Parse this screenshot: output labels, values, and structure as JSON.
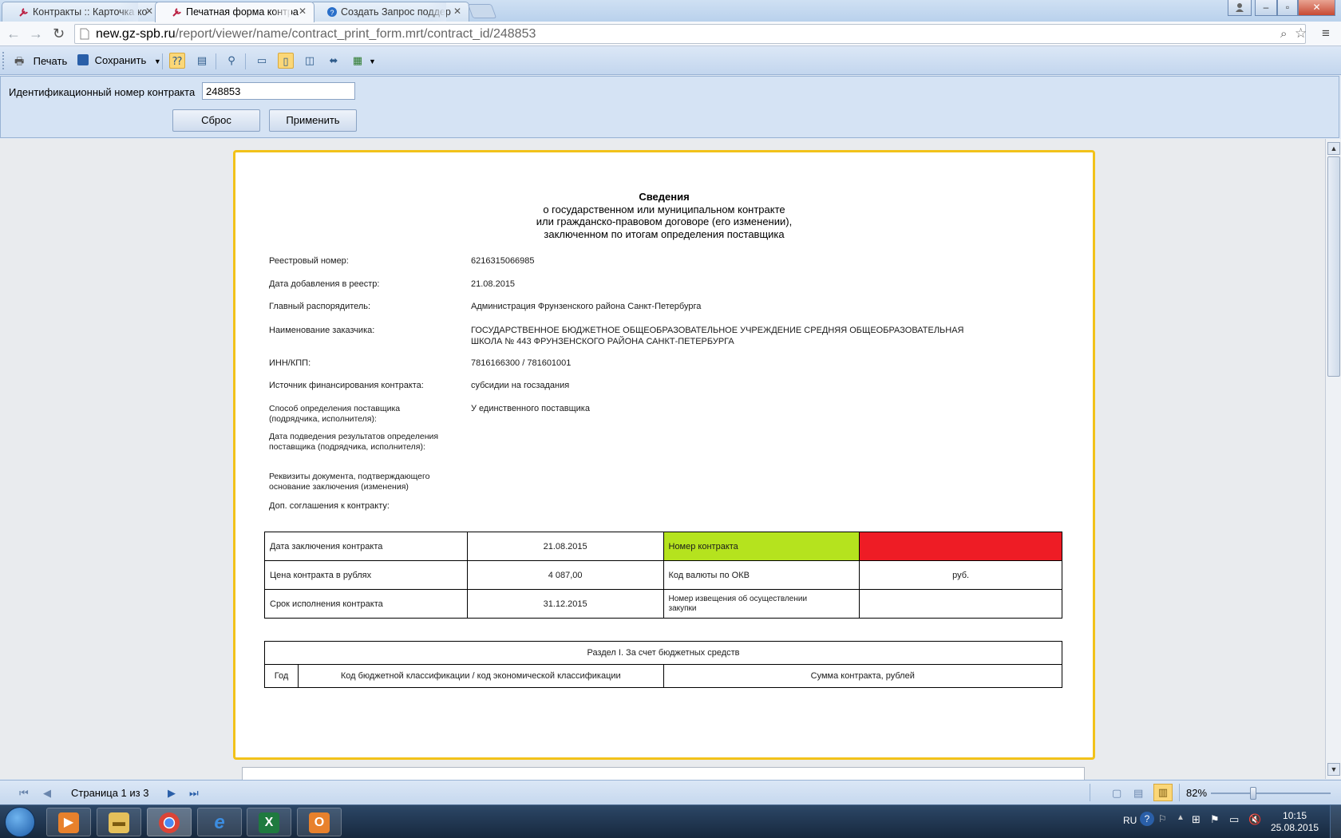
{
  "browser": {
    "tabs": [
      {
        "title": "Контракты :: Карточка ко",
        "active": false
      },
      {
        "title": "Печатная форма контра",
        "active": true
      },
      {
        "title": "Создать Запрос поддер",
        "active": false
      }
    ],
    "url_host": "new.gz-spb.ru",
    "url_path": "/report/viewer/name/contract_print_form.mrt/contract_id/248853"
  },
  "toolbar": {
    "print_label": "Печать",
    "save_label": "Сохранить"
  },
  "params": {
    "label": "Идентификационный номер контракта",
    "value": "248853",
    "reset_label": "Сброс",
    "apply_label": "Применить"
  },
  "document": {
    "title_lines": [
      "Сведения",
      "о государственном или муниципальном контракте",
      "или гражданско-правовом договоре (его изменении),",
      "заключенном по итогам определения поставщика"
    ],
    "fields": {
      "registry_label": "Реестровый номер:",
      "registry_value": "6216315066985",
      "date_added_label": "Дата добавления в реестр:",
      "date_added_value": "21.08.2015",
      "manager_label": "Главный распорядитель:",
      "manager_value": "Администрация Фрунзенского района Санкт-Петербурга",
      "customer_label": "Наименование заказчика:",
      "customer_value_1": "ГОСУДАРСТВЕННОЕ БЮДЖЕТНОЕ ОБЩЕОБРАЗОВАТЕЛЬНОЕ УЧРЕЖДЕНИЕ СРЕДНЯЯ ОБЩЕОБРАЗОВАТЕЛЬНАЯ",
      "customer_value_2": "ШКОЛА № 443 ФРУНЗЕНСКОГО РАЙОНА САНКТ-ПЕТЕРБУРГА",
      "inn_label": "ИНН/КПП:",
      "inn_value": "7816166300 / 781601001",
      "funding_label": "Источник финансирования контракта:",
      "funding_value": "субсидии на госзадания",
      "method_label_1": "Способ определения поставщика",
      "method_label_2": "(подрядчика, исполнителя):",
      "method_value": "У единственного поставщика",
      "results_date_label_1": "Дата подведения результатов определения",
      "results_date_label_2": "поставщика (подрядчика, исполнителя):",
      "requisites_label_1": "Реквизиты документа, подтверждающего",
      "requisites_label_2": "основание заключения (изменения)",
      "addenda_label": "Доп. соглашения к контракту:"
    },
    "contract_table": {
      "conclusion_date_label": "Дата заключения контракта",
      "conclusion_date_value": "21.08.2015",
      "contract_number_label": "Номер контракта",
      "contract_number_value": "",
      "price_label": "Цена контракта в рублях",
      "price_value": "4 087,00",
      "currency_code_label": "Код валюты по ОКВ",
      "currency_code_value": "руб.",
      "term_label": "Срок исполнения контракта",
      "term_value": "31.12.2015",
      "notice_label_1": "Номер извещения об осуществлении",
      "notice_label_2": "закупки",
      "notice_value": ""
    },
    "section_table": {
      "title": "Раздел I. За счет бюджетных средств",
      "col_year": "Год",
      "col_code": "Код бюджетной классификации / код экономической классификации",
      "col_sum": "Сумма контракта, рублей"
    }
  },
  "statusbar": {
    "page_info": "Страница 1 из 3",
    "zoom": "82%"
  },
  "taskbar": {
    "lang": "RU",
    "time": "10:15",
    "date": "25.08.2015"
  },
  "colors": {
    "contract_number_label_bg": "#b5e31e",
    "contract_number_value_bg": "#ee1c25",
    "page_border": "#f2c21a"
  }
}
